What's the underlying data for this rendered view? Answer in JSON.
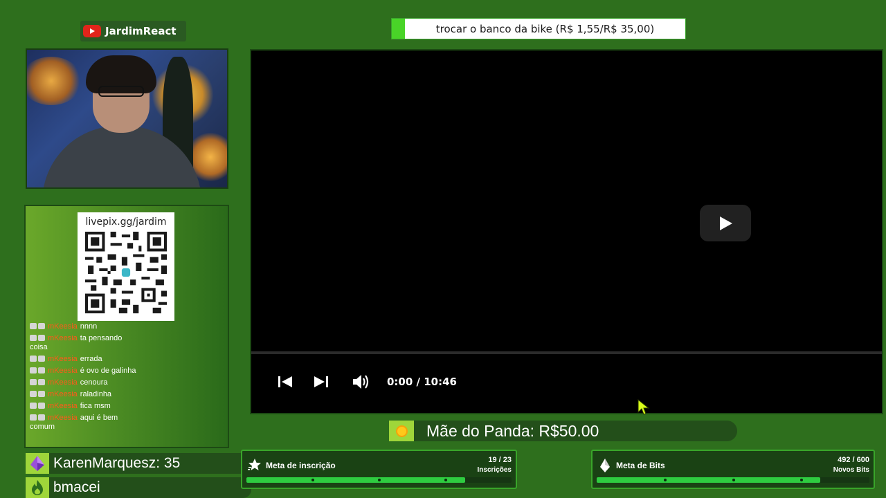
{
  "channel": {
    "name": "JardimReact",
    "icon": "youtube-icon"
  },
  "top_banner": {
    "text": "trocar o banco da bike (R$ 1,55/R$ 35,00)"
  },
  "qr": {
    "url": "livepix.gg/jardim"
  },
  "chat": {
    "messages": [
      {
        "user": "mKeesia",
        "text": "nnnn"
      },
      {
        "user": "mKeesia",
        "text": "ta pensando coisa"
      },
      {
        "user": "mKeesia",
        "text": "errada"
      },
      {
        "user": "mKeesia",
        "text": "é ovo de galinha"
      },
      {
        "user": "mKeesia",
        "text": "cenoura"
      },
      {
        "user": "mKeesia",
        "text": "raladinha"
      },
      {
        "user": "mKeesia",
        "text": "fica msm"
      },
      {
        "user": "mKeesia",
        "text": "aqui é bem comum"
      }
    ]
  },
  "alerts": {
    "recent_bits": {
      "text": "KarenMarquesz: 35",
      "icon": "bits-gem-icon"
    },
    "recent_follow": {
      "text": "bmacei",
      "icon": "fire-icon"
    }
  },
  "video": {
    "time": "0:00 / 10:46",
    "progress": 0
  },
  "donation": {
    "text": "Mãe do Panda: R$50.00",
    "icon": "coin-icon"
  },
  "goals": {
    "subs": {
      "title": "Meta de inscrição",
      "count": "19 / 23",
      "unit": "Inscrições",
      "current": 19,
      "target": 23
    },
    "bits": {
      "title": "Meta de Bits",
      "count": "492 / 600",
      "unit": "Novos Bits",
      "current": 492,
      "target": 600
    }
  },
  "colors": {
    "background": "#2e6f1d",
    "accent": "#9fd63a",
    "goal_fill": "#2ecc40",
    "youtube_red": "#e1241b",
    "chat_username": "#ff5a1a"
  }
}
